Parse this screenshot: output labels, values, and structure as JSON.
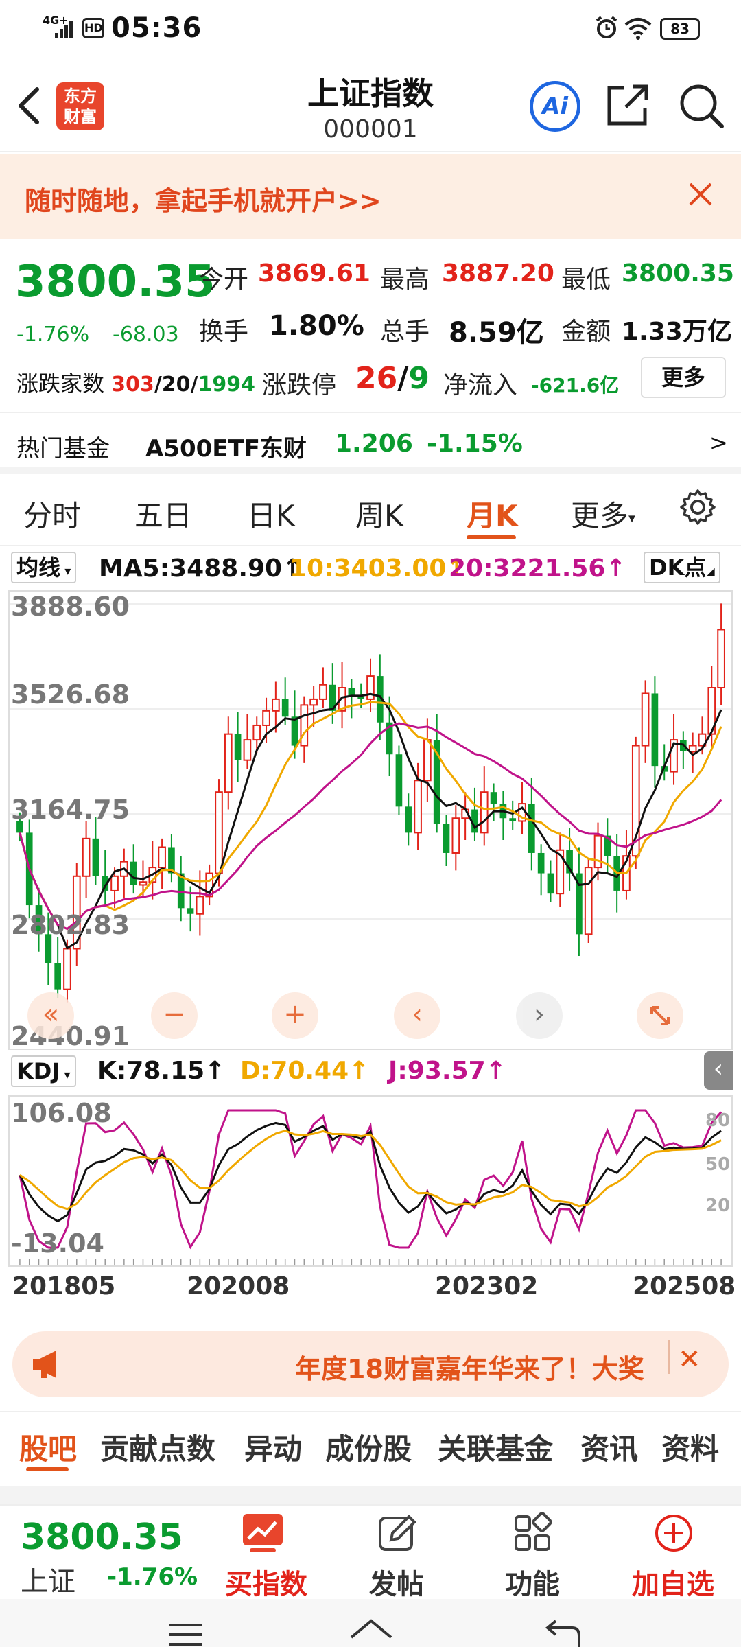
{
  "status_bar": {
    "network": "4G+",
    "hd": "HD",
    "time": "05:36",
    "battery": "83"
  },
  "header": {
    "logo_line1": "东方",
    "logo_line2": "财富",
    "title": "上证指数",
    "code": "000001",
    "ai_label": "Ai"
  },
  "banner": {
    "text": "随时随地，拿起手机就开户>>"
  },
  "quote": {
    "price": "3800.35",
    "change_pct": "-1.76%",
    "change": "-68.03",
    "open_label": "今开",
    "open": "3869.61",
    "high_label": "最高",
    "high": "3887.20",
    "low_label": "最低",
    "low": "3800.35",
    "turnover_label": "换手",
    "turnover": "1.80%",
    "volume_label": "总手",
    "volume": "8.59亿",
    "amount_label": "金额",
    "amount": "1.33万亿",
    "breadth_label": "涨跌家数",
    "breadth_up": "303",
    "breadth_flat": "20",
    "breadth_down": "1994",
    "limit_label": "涨跌停",
    "limit_up": "26",
    "limit_down": "9",
    "inflow_label": "净流入",
    "inflow": "-621.6亿",
    "more": "更多"
  },
  "hot_fund": {
    "label": "热门基金",
    "name": "A500ETF东财",
    "price": "1.206",
    "change": "-1.15%",
    "arrow": ">"
  },
  "tabs": [
    "分时",
    "五日",
    "日K",
    "周K",
    "月K",
    "更多"
  ],
  "ma_row": {
    "selector": "均线",
    "ma5": "MA5:3488.90↑",
    "ma10": "10:3403.00↑",
    "ma20": "20:3221.56↑",
    "dk": "DK点"
  },
  "kline_axis": {
    "y_ticks": [
      "3888.60",
      "3526.68",
      "3164.75",
      "2802.83",
      "2440.91"
    ]
  },
  "chart_controls": {
    "prev_far": "«",
    "minus": "−",
    "plus": "+",
    "prev": "‹",
    "next": "›"
  },
  "kdj_row": {
    "selector": "KDJ",
    "k": "K:78.15↑",
    "d": "D:70.44↑",
    "j": "J:93.57↑"
  },
  "kdj_axis": {
    "y_top": "106.08",
    "y_bottom": "-13.04",
    "r80": "80",
    "r50": "50",
    "r20": "20"
  },
  "x_ticks": [
    "201805",
    "202008",
    "202302",
    "202508"
  ],
  "colors": {
    "up": "#e2231a",
    "down": "#0a9b2f",
    "ma5": "#111111",
    "ma10": "#f0a800",
    "ma20": "#c0138a",
    "accent": "#e2531a"
  },
  "chart_data": {
    "type": "candlestick",
    "ylim": [
      2440.91,
      3888.6
    ],
    "candles_approx_close": [
      3100,
      2850,
      2750,
      2650,
      2560,
      2700,
      2950,
      3080,
      2950,
      2900,
      2950,
      3000,
      2920,
      2930,
      2980,
      3050,
      2960,
      2840,
      2820,
      2880,
      2960,
      3240,
      3440,
      3350,
      3420,
      3470,
      3520,
      3560,
      3500,
      3400,
      3540,
      3560,
      3610,
      3520,
      3600,
      3570,
      3560,
      3640,
      3480,
      3370,
      3190,
      3100,
      3280,
      3420,
      3130,
      3030,
      3150,
      3180,
      3100,
      3240,
      3200,
      3150,
      3140,
      3200,
      3030,
      2960,
      2890,
      3040,
      2960,
      2750,
      2980,
      3090,
      3020,
      2900,
      3020,
      3400,
      3580,
      3330,
      3310,
      3420,
      3380,
      3400,
      3440,
      3600,
      3800
    ],
    "kdj_ylim": [
      -13.04,
      106.08
    ]
  },
  "promo": {
    "text": "年度18财富嘉年华来了！大奖",
    "close": "✕"
  },
  "bottom_tabs": [
    "股吧",
    "贡献点数",
    "异动",
    "成份股",
    "关联基金",
    "资讯",
    "资料"
  ],
  "footer": {
    "price": "3800.35",
    "name": "上证",
    "change": "-1.76%",
    "buy": "买指数",
    "post": "发帖",
    "func": "功能",
    "add": "加自选"
  }
}
